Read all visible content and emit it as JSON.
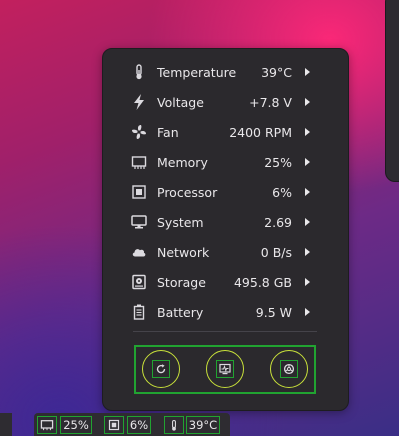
{
  "menu": {
    "items": [
      {
        "icon": "thermometer-icon",
        "label": "Temperature",
        "value": "39°C"
      },
      {
        "icon": "lightning-icon",
        "label": "Voltage",
        "value": "+7.8 V"
      },
      {
        "icon": "fan-icon",
        "label": "Fan",
        "value": "2400 RPM"
      },
      {
        "icon": "memory-chip-icon",
        "label": "Memory",
        "value": "25%"
      },
      {
        "icon": "processor-icon",
        "label": "Processor",
        "value": "6%"
      },
      {
        "icon": "monitor-icon",
        "label": "System",
        "value": "2.69"
      },
      {
        "icon": "cloud-icon",
        "label": "Network",
        "value": "0 B/s"
      },
      {
        "icon": "harddisk-icon",
        "label": "Storage",
        "value": "495.8 GB"
      },
      {
        "icon": "battery-icon",
        "label": "Battery",
        "value": "9.5 W"
      }
    ]
  },
  "actions": [
    {
      "icon": "refresh-icon"
    },
    {
      "icon": "system-monitor-icon"
    },
    {
      "icon": "settings-icon"
    }
  ],
  "panel": {
    "memory_value": "25%",
    "processor_value": "6%",
    "temperature_value": "39°C"
  },
  "colors": {
    "popup_bg": "#2b292d",
    "text": "#e9e7ea",
    "highlight_green": "#21a331",
    "highlight_yellow": "#c8e03a"
  }
}
